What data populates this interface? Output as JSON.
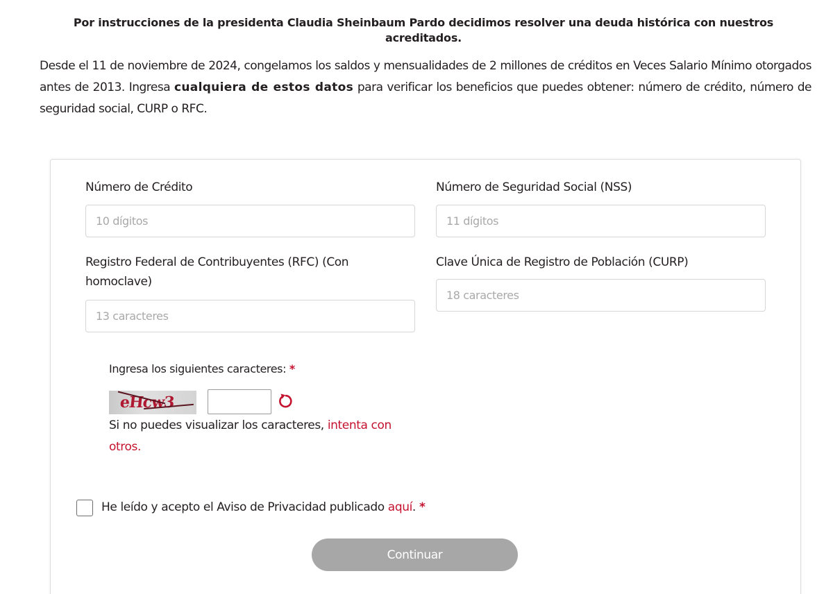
{
  "intro": {
    "title": "Por instrucciones de la presidenta Claudia Sheinbaum Pardo decidimos resolver una deuda histórica con nuestros acreditados.",
    "text_before": "Desde el 11 de noviembre de 2024, congelamos los saldos y mensualidades de 2 millones de créditos en Veces Salario Mínimo otorgados antes de 2013. Ingresa ",
    "text_strong": "cualquiera de estos datos",
    "text_after": " para verificar los beneficios que puedes obtener: número de crédito, número de seguridad social, CURP o RFC."
  },
  "form": {
    "credit": {
      "label": "Número de Crédito",
      "placeholder": "10 dígitos"
    },
    "nss": {
      "label": "Número de Seguridad Social (NSS)",
      "placeholder": "11 dígitos"
    },
    "rfc": {
      "label": "Registro Federal de Contribuyentes (RFC) (Con homoclave)",
      "placeholder": "13 caracteres"
    },
    "curp": {
      "label": "Clave Única de Registro de Población (CURP)",
      "placeholder": "18 caracteres"
    },
    "captcha": {
      "label": "Ingresa los siguientes caracteres:",
      "required_mark": "*",
      "image_text": "eHcw3",
      "help_text": "Si no puedes visualizar los caracteres, ",
      "help_link": "intenta con otros."
    },
    "consent": {
      "text": "He leído y acepto el Aviso de Privacidad publicado ",
      "link": "aquí",
      "after_link": ".",
      "required_mark": "*",
      "checked": false
    },
    "continue_label": "Continuar"
  },
  "colors": {
    "accent": "#c4122f",
    "button_disabled": "#a7a7a7",
    "text": "#231f20"
  }
}
